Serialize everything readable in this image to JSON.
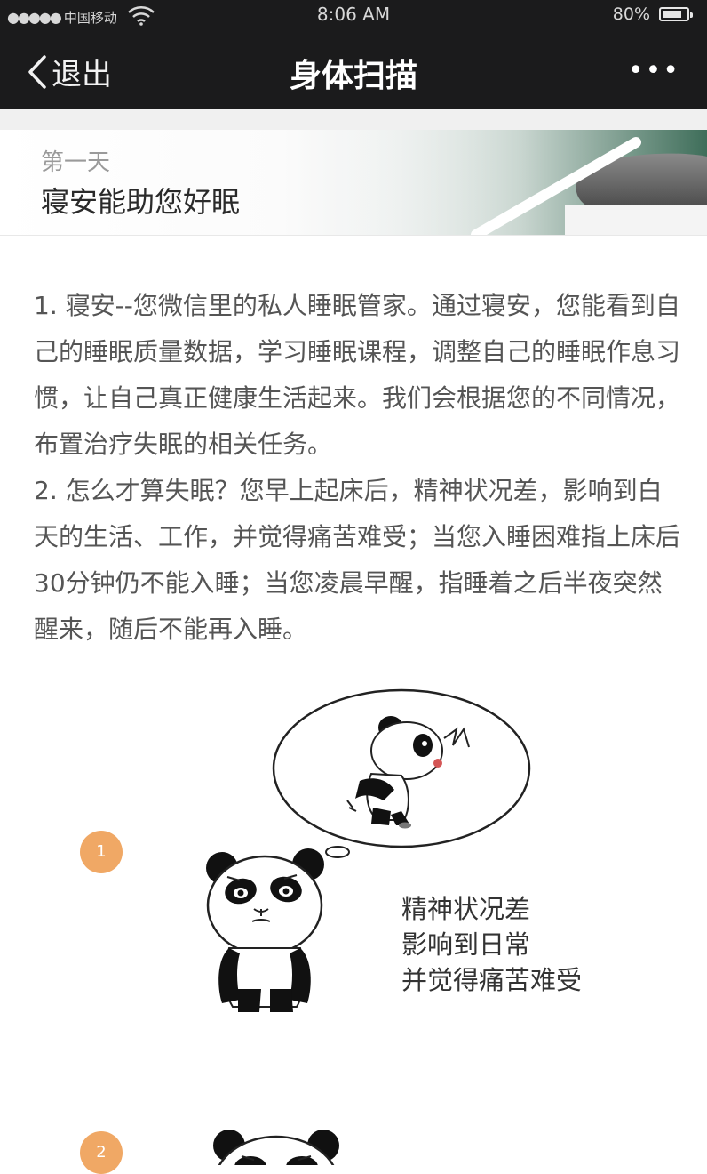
{
  "status_bar": {
    "signal_dots": "●●●●●",
    "carrier": "中国移动",
    "time": "8:06 AM",
    "battery": "80%",
    "battery_level": 0.8
  },
  "nav": {
    "back_label": "退出",
    "title": "身体扫描",
    "more_label": "•••"
  },
  "banner": {
    "day": "第一天",
    "title": "寝安能助您好眠"
  },
  "content": {
    "paragraphs": [
      "1. 寝安--您微信里的私人睡眠管家。通过寝安，您能看到自己的睡眠质量数据，学习睡眠课程，调整自己的睡眠作息习惯，让自己真正健康生活起来。我们会根据您的不同情况，布置治疗失眠的相关任务。",
      "2. 怎么才算失眠？您早上起床后，精神状况差，影响到白天的生活、工作，并觉得痛苦难受；当您入睡困难指上床后30分钟仍不能入睡；当您凌晨早醒，指睡着之后半夜突然醒来，随后不能再入睡。"
    ]
  },
  "illustration": {
    "step1_number": "1",
    "step2_number": "2",
    "caption_lines": [
      "精神状况差",
      "影响到日常",
      "并觉得痛苦难受"
    ]
  },
  "icons": {
    "back": "chevron-left-icon",
    "wifi": "wifi-icon",
    "battery": "battery-icon",
    "more": "more-icon"
  },
  "colors": {
    "bar_bg": "#1b1b1c",
    "accent_orange": "#f0a865"
  }
}
